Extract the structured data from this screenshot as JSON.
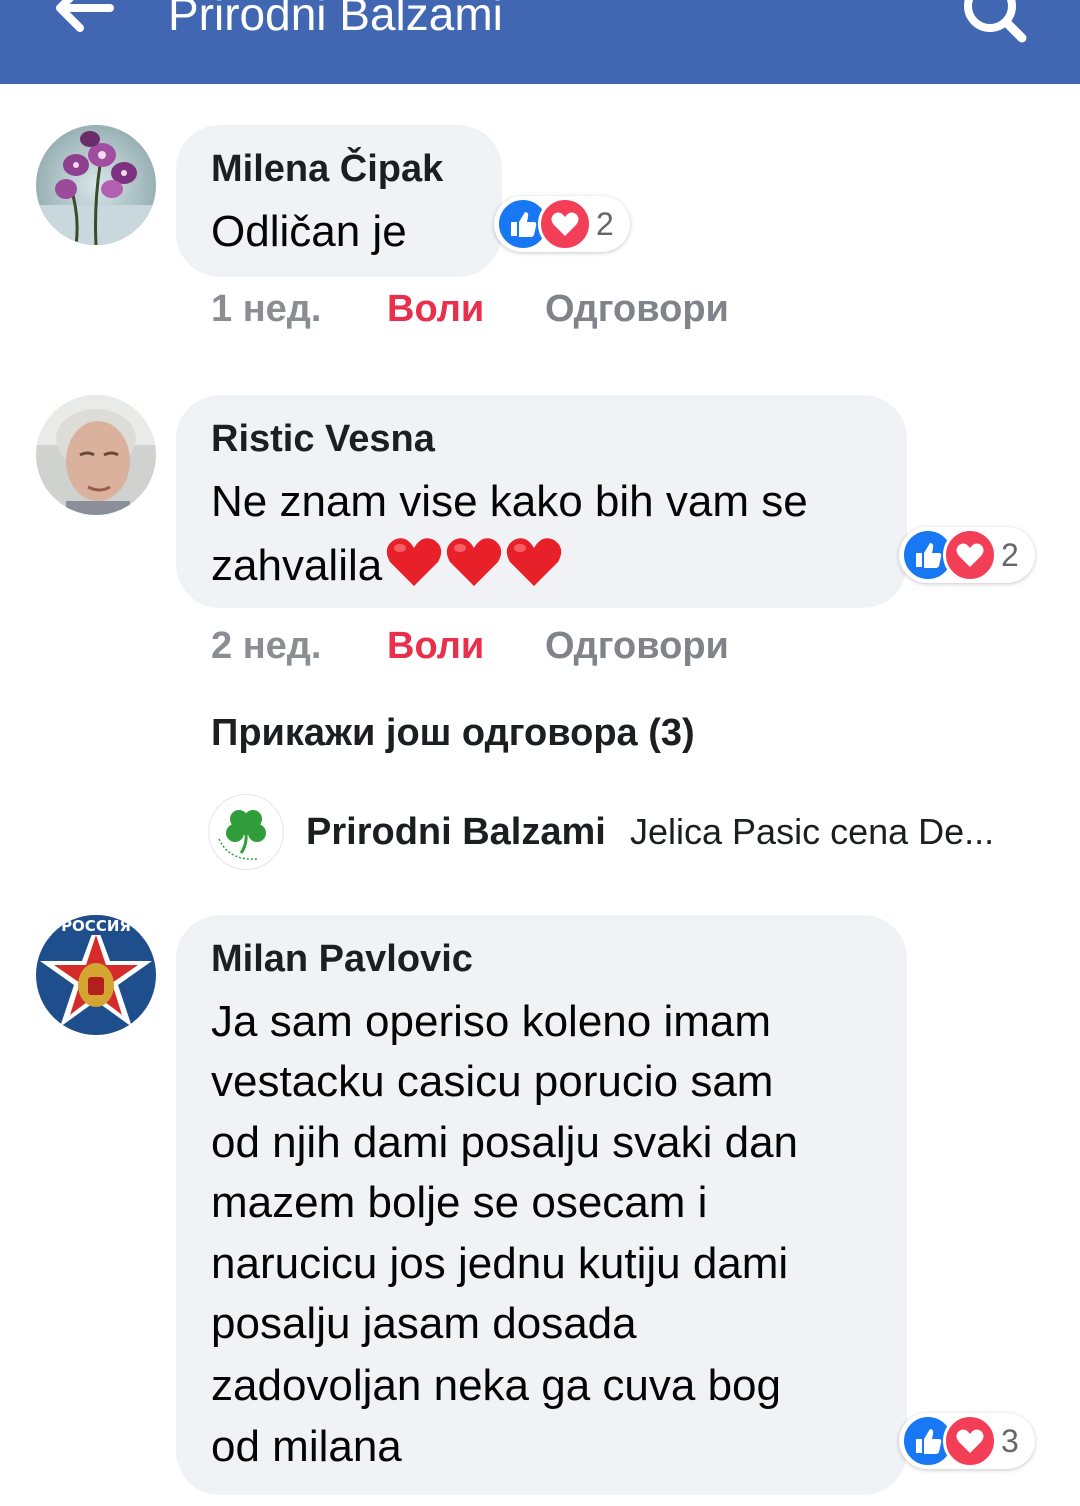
{
  "header": {
    "title": "Prirodni Balzami",
    "back_icon": "arrow-left-icon",
    "search_icon": "search-icon",
    "color": "#4267b2"
  },
  "comments": [
    {
      "author": "Milena Čipak",
      "lines": [
        "Odličan je"
      ],
      "reactions": {
        "types": [
          "like",
          "love"
        ],
        "count": "2"
      },
      "time": "1 нед.",
      "like_label": "Воли",
      "reply_label": "Одговори"
    },
    {
      "author": "Ristic Vesna",
      "lines": [
        "Ne znam vise kako bih vam se",
        "zahvalila"
      ],
      "emoji": "❤❤❤",
      "reactions": {
        "types": [
          "like",
          "love"
        ],
        "count": "2"
      },
      "time": "2 нед.",
      "like_label": "Воли",
      "reply_label": "Одговори",
      "more_replies": "Прикажи још одговора (3)",
      "reply_preview": {
        "author": "Prirodni Balzami",
        "text": "Jelica Pasic cena De..."
      }
    },
    {
      "author": "Milan Pavlovic",
      "avatar_text": "РОССИЯ",
      "lines": [
        "Ja sam operiso koleno imam",
        "vestacku casicu porucio sam",
        "od njih dami posalju svaki dan",
        "mazem bolje se osecam i",
        "narucicu jos jednu kutiju dami",
        "posalju jasam dosada",
        "zadovoljan neka ga cuva bog",
        "od milana"
      ],
      "reactions": {
        "types": [
          "like",
          "love"
        ],
        "count": "3"
      }
    }
  ],
  "colors": {
    "bubble": "#f0f2f5",
    "like_link": "#e8304c",
    "like_reaction": "#1877f2",
    "love_reaction": "#f33e58"
  }
}
